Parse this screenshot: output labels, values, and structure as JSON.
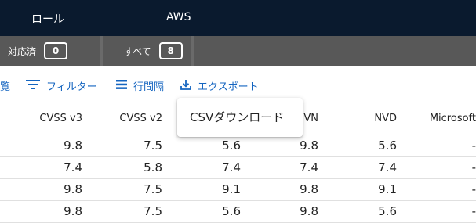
{
  "topbar": {
    "role_label": "ロール",
    "aws_label": "AWS"
  },
  "tabs": [
    {
      "label": "対応済",
      "count": "0"
    },
    {
      "label": "すべて",
      "count": "8"
    }
  ],
  "toolbar": {
    "view_label": "覧",
    "filter_label": "フィルター",
    "density_label": "行間隔",
    "export_label": "エクスポート"
  },
  "export_menu": {
    "csv_download": "CSVダウンロード"
  },
  "table": {
    "headers": [
      "CVSS v3",
      "CVSS v2",
      "",
      "VN",
      "NVD",
      "Microsoft"
    ],
    "rows": [
      [
        "9.8",
        "7.5",
        "5.6",
        "9.8",
        "5.6",
        "-"
      ],
      [
        "7.4",
        "5.8",
        "7.4",
        "7.4",
        "7.4",
        "-"
      ],
      [
        "9.8",
        "7.5",
        "9.1",
        "9.8",
        "9.1",
        "-"
      ],
      [
        "9.8",
        "7.5",
        "5.6",
        "9.8",
        "5.6",
        "-"
      ]
    ]
  },
  "colors": {
    "topbar_bg": "#0a1a2e",
    "tabbar_bg": "#585858",
    "accent": "#1565c0"
  }
}
